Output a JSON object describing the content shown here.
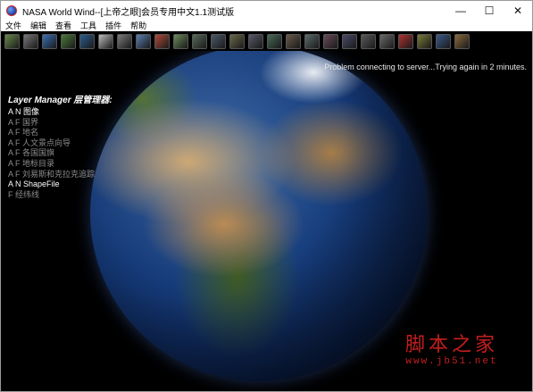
{
  "window": {
    "title": "NASA World Wind--[上帝之眼]会员专用中文1.1测试版",
    "controls": {
      "minimize": "—",
      "maximize": "☐",
      "close": "✕"
    }
  },
  "menu": [
    "文件",
    "编辑",
    "查看",
    "工具",
    "插件",
    "帮助"
  ],
  "toolbar": {
    "icons": [
      {
        "name": "layers-icon",
        "color": "#6a8a4a"
      },
      {
        "name": "grid-icon",
        "color": "#777777"
      },
      {
        "name": "globe-icon",
        "color": "#3a6fb5"
      },
      {
        "name": "world-icon",
        "color": "#4a7a3a"
      },
      {
        "name": "earth-icon",
        "color": "#2d5e8e"
      },
      {
        "name": "search-icon",
        "color": "#bbbbbb"
      },
      {
        "name": "satellite-icon",
        "color": "#7b7b7b"
      },
      {
        "name": "map-icon",
        "color": "#5b7fb0"
      },
      {
        "name": "heatmap-icon",
        "color": "#b04a3a"
      },
      {
        "name": "terrain-icon",
        "color": "#6b8a5a"
      },
      {
        "name": "image-icon-1",
        "color": "#5a6a5a"
      },
      {
        "name": "image-icon-2",
        "color": "#4a5a6a"
      },
      {
        "name": "image-icon-3",
        "color": "#6a6a4a"
      },
      {
        "name": "image-icon-4",
        "color": "#5a5a6a"
      },
      {
        "name": "image-icon-5",
        "color": "#4a6a5a"
      },
      {
        "name": "image-icon-6",
        "color": "#6a5a4a"
      },
      {
        "name": "image-icon-7",
        "color": "#5a6a6a"
      },
      {
        "name": "image-icon-8",
        "color": "#6a4a5a"
      },
      {
        "name": "image-icon-9",
        "color": "#4a4a6a"
      },
      {
        "name": "image-icon-10",
        "color": "#5a5a5a"
      },
      {
        "name": "image-icon-11",
        "color": "#6a6a6a"
      },
      {
        "name": "flag-icon",
        "color": "#b03030"
      },
      {
        "name": "chart-icon",
        "color": "#7a7a3a"
      },
      {
        "name": "globe-icon-2",
        "color": "#3a5a8a"
      },
      {
        "name": "map-icon-2",
        "color": "#8a6a3a"
      }
    ]
  },
  "status_message": "Problem connecting to server...Trying again in 2 minutes.",
  "layer_manager": {
    "title": "Layer Manager 层管理器:",
    "items": [
      {
        "label": "A N 图像",
        "active": true
      },
      {
        "label": "A F 国界",
        "active": false
      },
      {
        "label": "A F 地名",
        "active": false
      },
      {
        "label": "A F 人文景点向导",
        "active": false
      },
      {
        "label": "A F 各国国旗",
        "active": false
      },
      {
        "label": "A F 地标目录",
        "active": false
      },
      {
        "label": "A F 刘易斯和克拉克追踪",
        "active": false
      },
      {
        "label": "A N ShapeFile",
        "active": true
      },
      {
        "label": "   F 经纬线",
        "active": false
      }
    ]
  },
  "watermark": {
    "logo": "脚本之家",
    "url": "www.jb51.net"
  }
}
